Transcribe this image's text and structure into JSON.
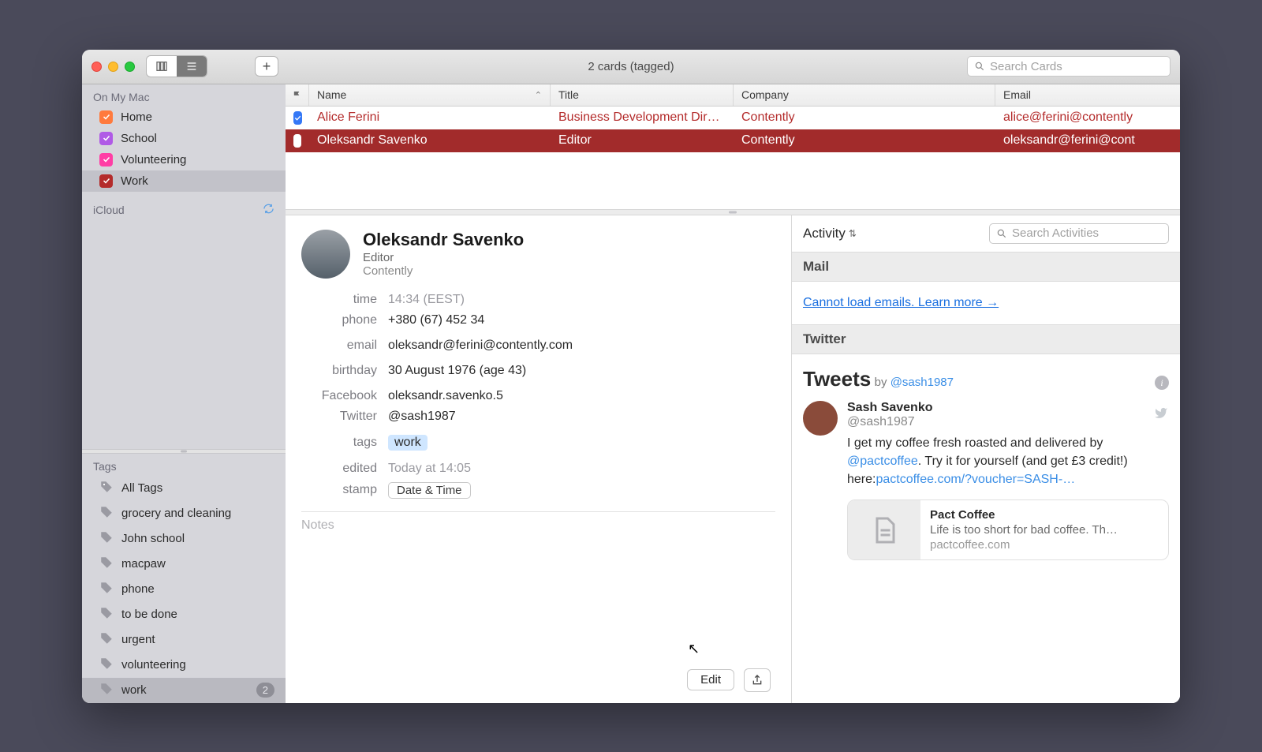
{
  "window": {
    "title": "2 cards (tagged)",
    "search_placeholder": "Search Cards"
  },
  "sidebar": {
    "section1_label": "On My Mac",
    "groups": [
      {
        "label": "Home",
        "color": "#ff7a3d"
      },
      {
        "label": "School",
        "color": "#b05ae6"
      },
      {
        "label": "Volunteering",
        "color": "#ff3ea5"
      },
      {
        "label": "Work",
        "color": "#b42b2b",
        "selected": true
      }
    ],
    "section2_label": "iCloud",
    "tags_label": "Tags",
    "tags": [
      {
        "label": "All Tags"
      },
      {
        "label": "grocery and cleaning"
      },
      {
        "label": "John school"
      },
      {
        "label": "macpaw"
      },
      {
        "label": "phone"
      },
      {
        "label": "to be done"
      },
      {
        "label": "urgent"
      },
      {
        "label": "volunteering"
      },
      {
        "label": "work",
        "count": "2",
        "selected": true
      }
    ]
  },
  "table": {
    "columns": {
      "name": "Name",
      "title": "Title",
      "company": "Company",
      "email": "Email"
    },
    "rows": [
      {
        "name": "Alice Ferini",
        "title": "Business Development Dire…",
        "company": "Contently",
        "email": "alice@ferini@contently",
        "flag_color": "#3478f6",
        "flag_checked": true
      },
      {
        "name": "Oleksandr Savenko",
        "title": "Editor",
        "company": "Contently",
        "email": "oleksandr@ferini@cont",
        "selected": true
      }
    ]
  },
  "card": {
    "name": "Oleksandr Savenko",
    "role": "Editor",
    "company": "Contently",
    "fields": {
      "time_label": "time",
      "time_value": "14:34 (EEST)",
      "phone_label": "phone",
      "phone_value": "+380 (67) 452 34",
      "email_label": "email",
      "email_value": "oleksandr@ferini@contently.com",
      "birthday_label": "birthday",
      "birthday_value": "30 August 1976 (age 43)",
      "facebook_label": "Facebook",
      "facebook_value": "oleksandr.savenko.5",
      "twitter_label": "Twitter",
      "twitter_value": "@sash1987",
      "tags_label": "tags",
      "tags_value": "work",
      "edited_label": "edited",
      "edited_value": "Today at 14:05",
      "stamp_label": "stamp",
      "stamp_button": "Date & Time"
    },
    "notes_placeholder": "Notes",
    "edit_button": "Edit"
  },
  "activity": {
    "title": "Activity",
    "search_placeholder": "Search Activities",
    "mail_header": "Mail",
    "mail_link": "Cannot load emails. Learn more →",
    "twitter_header": "Twitter",
    "tweets_label": "Tweets",
    "tweets_by_prefix": "by ",
    "tweets_by_handle": "@sash1987",
    "tweet": {
      "name": "Sash Savenko",
      "handle": "@sash1987",
      "text_1": "I get my coffee fresh roasted and delivered by ",
      "mention": "@pactcoffee",
      "text_2": ". Try it for yourself (and get £3 credit!) here:",
      "link": "pactcoffee.com/?voucher=SASH-…"
    },
    "embed": {
      "title": "Pact Coffee",
      "desc": "Life is too short for bad coffee. Th…",
      "url": "pactcoffee.com"
    }
  }
}
